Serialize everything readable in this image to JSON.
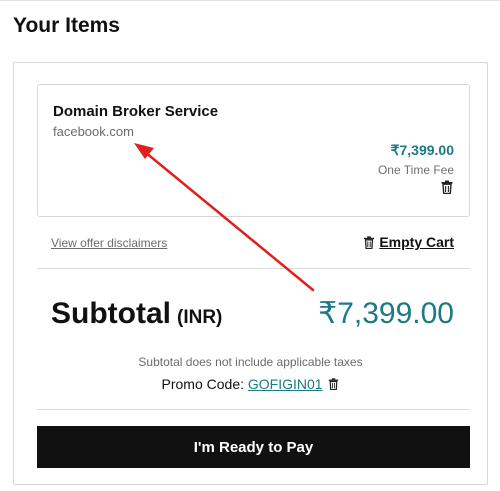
{
  "page": {
    "title": "Your Items"
  },
  "item": {
    "name": "Domain Broker Service",
    "domain": "facebook.com",
    "price": "₹7,399.00",
    "fee_type": "One Time Fee",
    "delete_icon": "trash-icon"
  },
  "links": {
    "disclaimers": "View offer disclaimers",
    "empty_cart": "Empty Cart",
    "empty_cart_icon": "trash-icon"
  },
  "summary": {
    "subtotal_label": "Subtotal",
    "currency": "(INR)",
    "subtotal_amount": "₹7,399.00",
    "tax_note": "Subtotal does not include applicable taxes",
    "promo_label": "Promo Code: ",
    "promo_code": "GOFIGIN01",
    "promo_remove_icon": "trash-icon"
  },
  "actions": {
    "pay_label": "I'm Ready to Pay"
  },
  "colors": {
    "accent_teal": "#1b7a84",
    "button_bg": "#111111",
    "annotation_red": "#e0201d"
  }
}
